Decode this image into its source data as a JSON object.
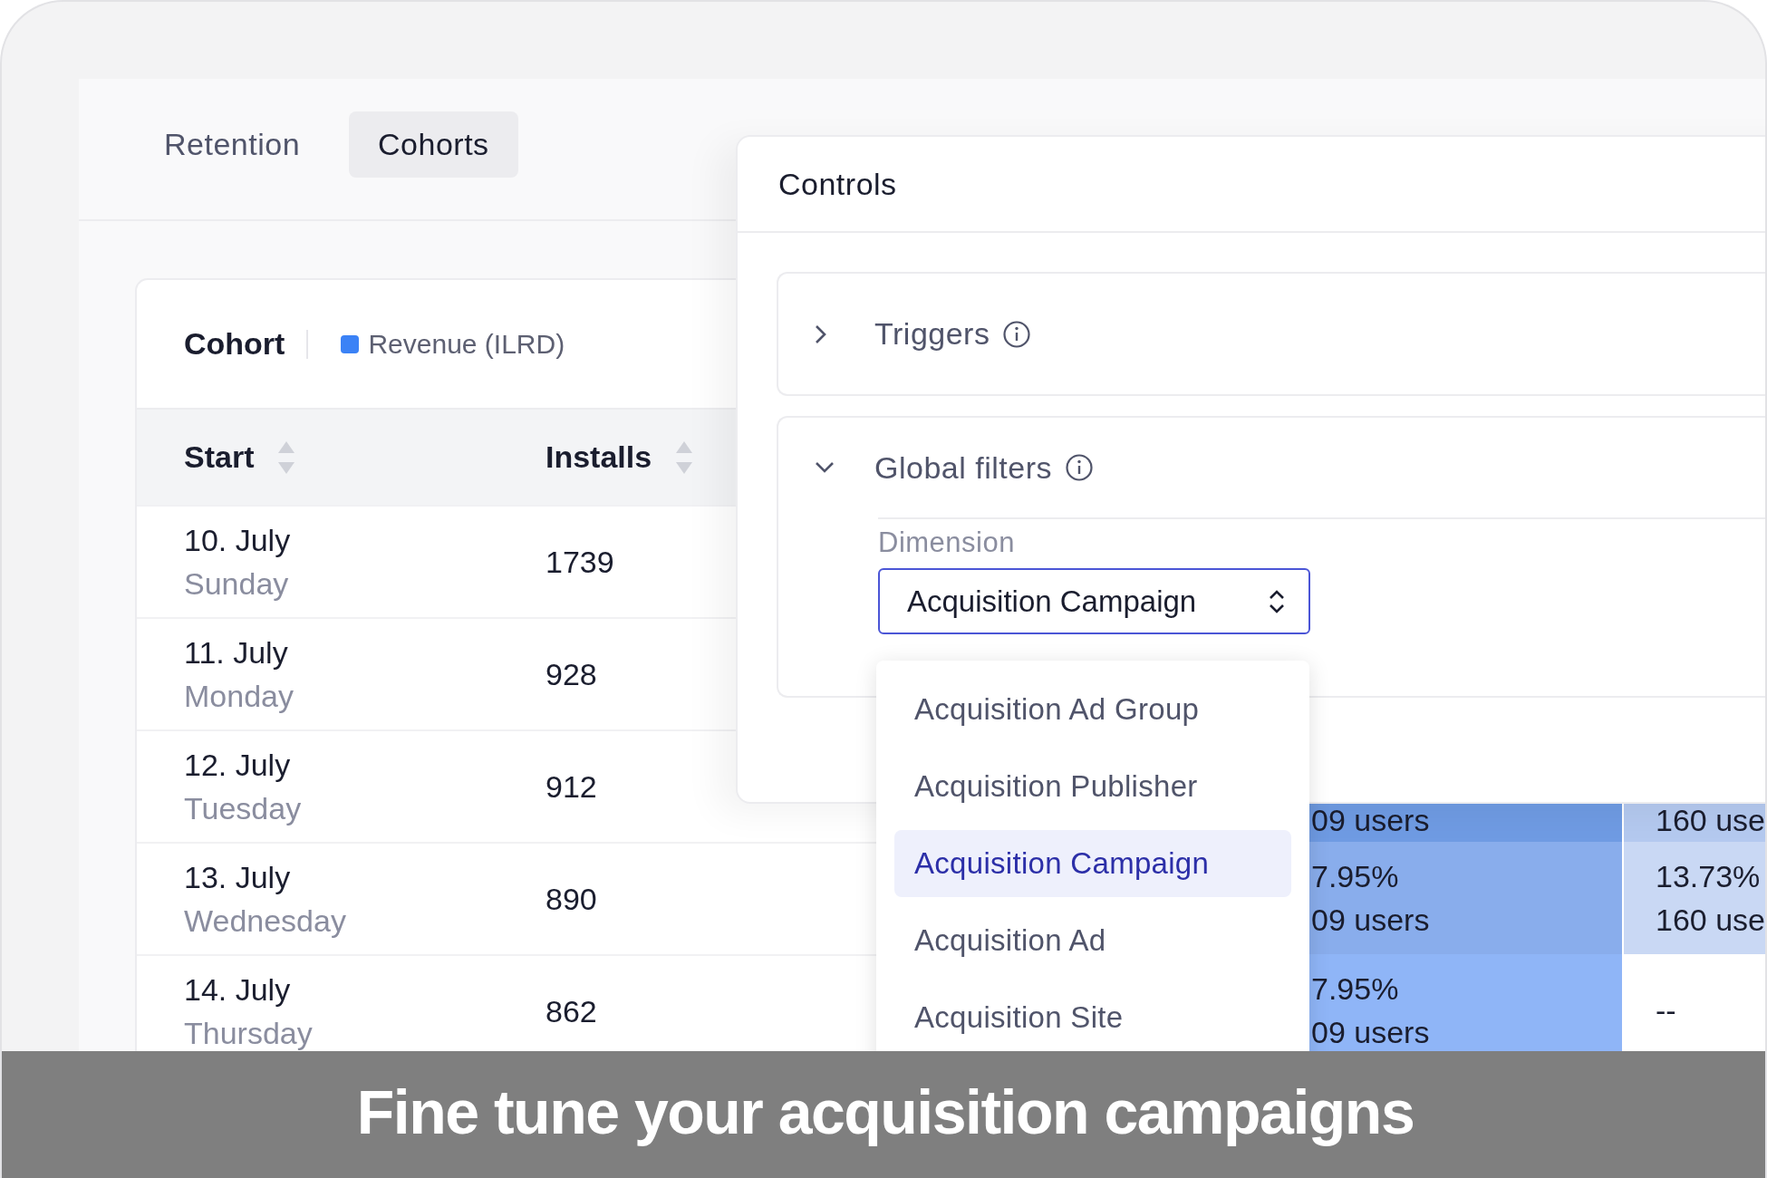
{
  "tabs": [
    {
      "label": "Retention",
      "selected": false
    },
    {
      "label": "Cohorts",
      "selected": true
    }
  ],
  "cohort_card": {
    "title": "Cohort",
    "legend": {
      "label": "Revenue (ILRD)",
      "color": "#3b82f6"
    },
    "columns": [
      {
        "label": "Start"
      },
      {
        "label": "Installs"
      }
    ],
    "rows": [
      {
        "date": "10. July",
        "weekday": "Sunday",
        "installs": "1739",
        "cells": []
      },
      {
        "date": "11. July",
        "weekday": "Monday",
        "installs": "928",
        "cells": []
      },
      {
        "date": "12. July",
        "weekday": "Tuesday",
        "installs": "912",
        "cells": [
          {
            "lines": [
              "09 users"
            ],
            "color": "#6f9be3"
          },
          {
            "lines": [
              "160 use"
            ],
            "color": "#b4c9ef"
          }
        ]
      },
      {
        "date": "13. July",
        "weekday": "Wednesday",
        "installs": "890",
        "cells": [
          {
            "lines": [
              "7.95%",
              "09 users"
            ],
            "color": "#89adec"
          },
          {
            "lines": [
              "13.73%",
              "160 use"
            ],
            "color": "#c9d8f4"
          }
        ]
      },
      {
        "date": "14. July",
        "weekday": "Thursday",
        "installs": "862",
        "cells": [
          {
            "lines": [
              "7.95%",
              "09 users"
            ],
            "color": "#8fb5f7"
          },
          {
            "lines": [
              "--"
            ],
            "color": "#ffffff"
          }
        ]
      }
    ]
  },
  "controls": {
    "title": "Controls",
    "sections": [
      {
        "title": "Triggers",
        "expanded": false
      },
      {
        "title": "Global filters",
        "expanded": true,
        "filter": {
          "label": "Dimension",
          "value": "Acquisition Campaign",
          "options": [
            {
              "label": "Acquisition Ad Group",
              "selected": false
            },
            {
              "label": "Acquisition Publisher",
              "selected": false
            },
            {
              "label": "Acquisition Campaign",
              "selected": true
            },
            {
              "label": "Acquisition Ad",
              "selected": false
            },
            {
              "label": "Acquisition Site",
              "selected": false
            }
          ]
        }
      }
    ]
  },
  "caption": "Fine tune your acquisition campaigns"
}
